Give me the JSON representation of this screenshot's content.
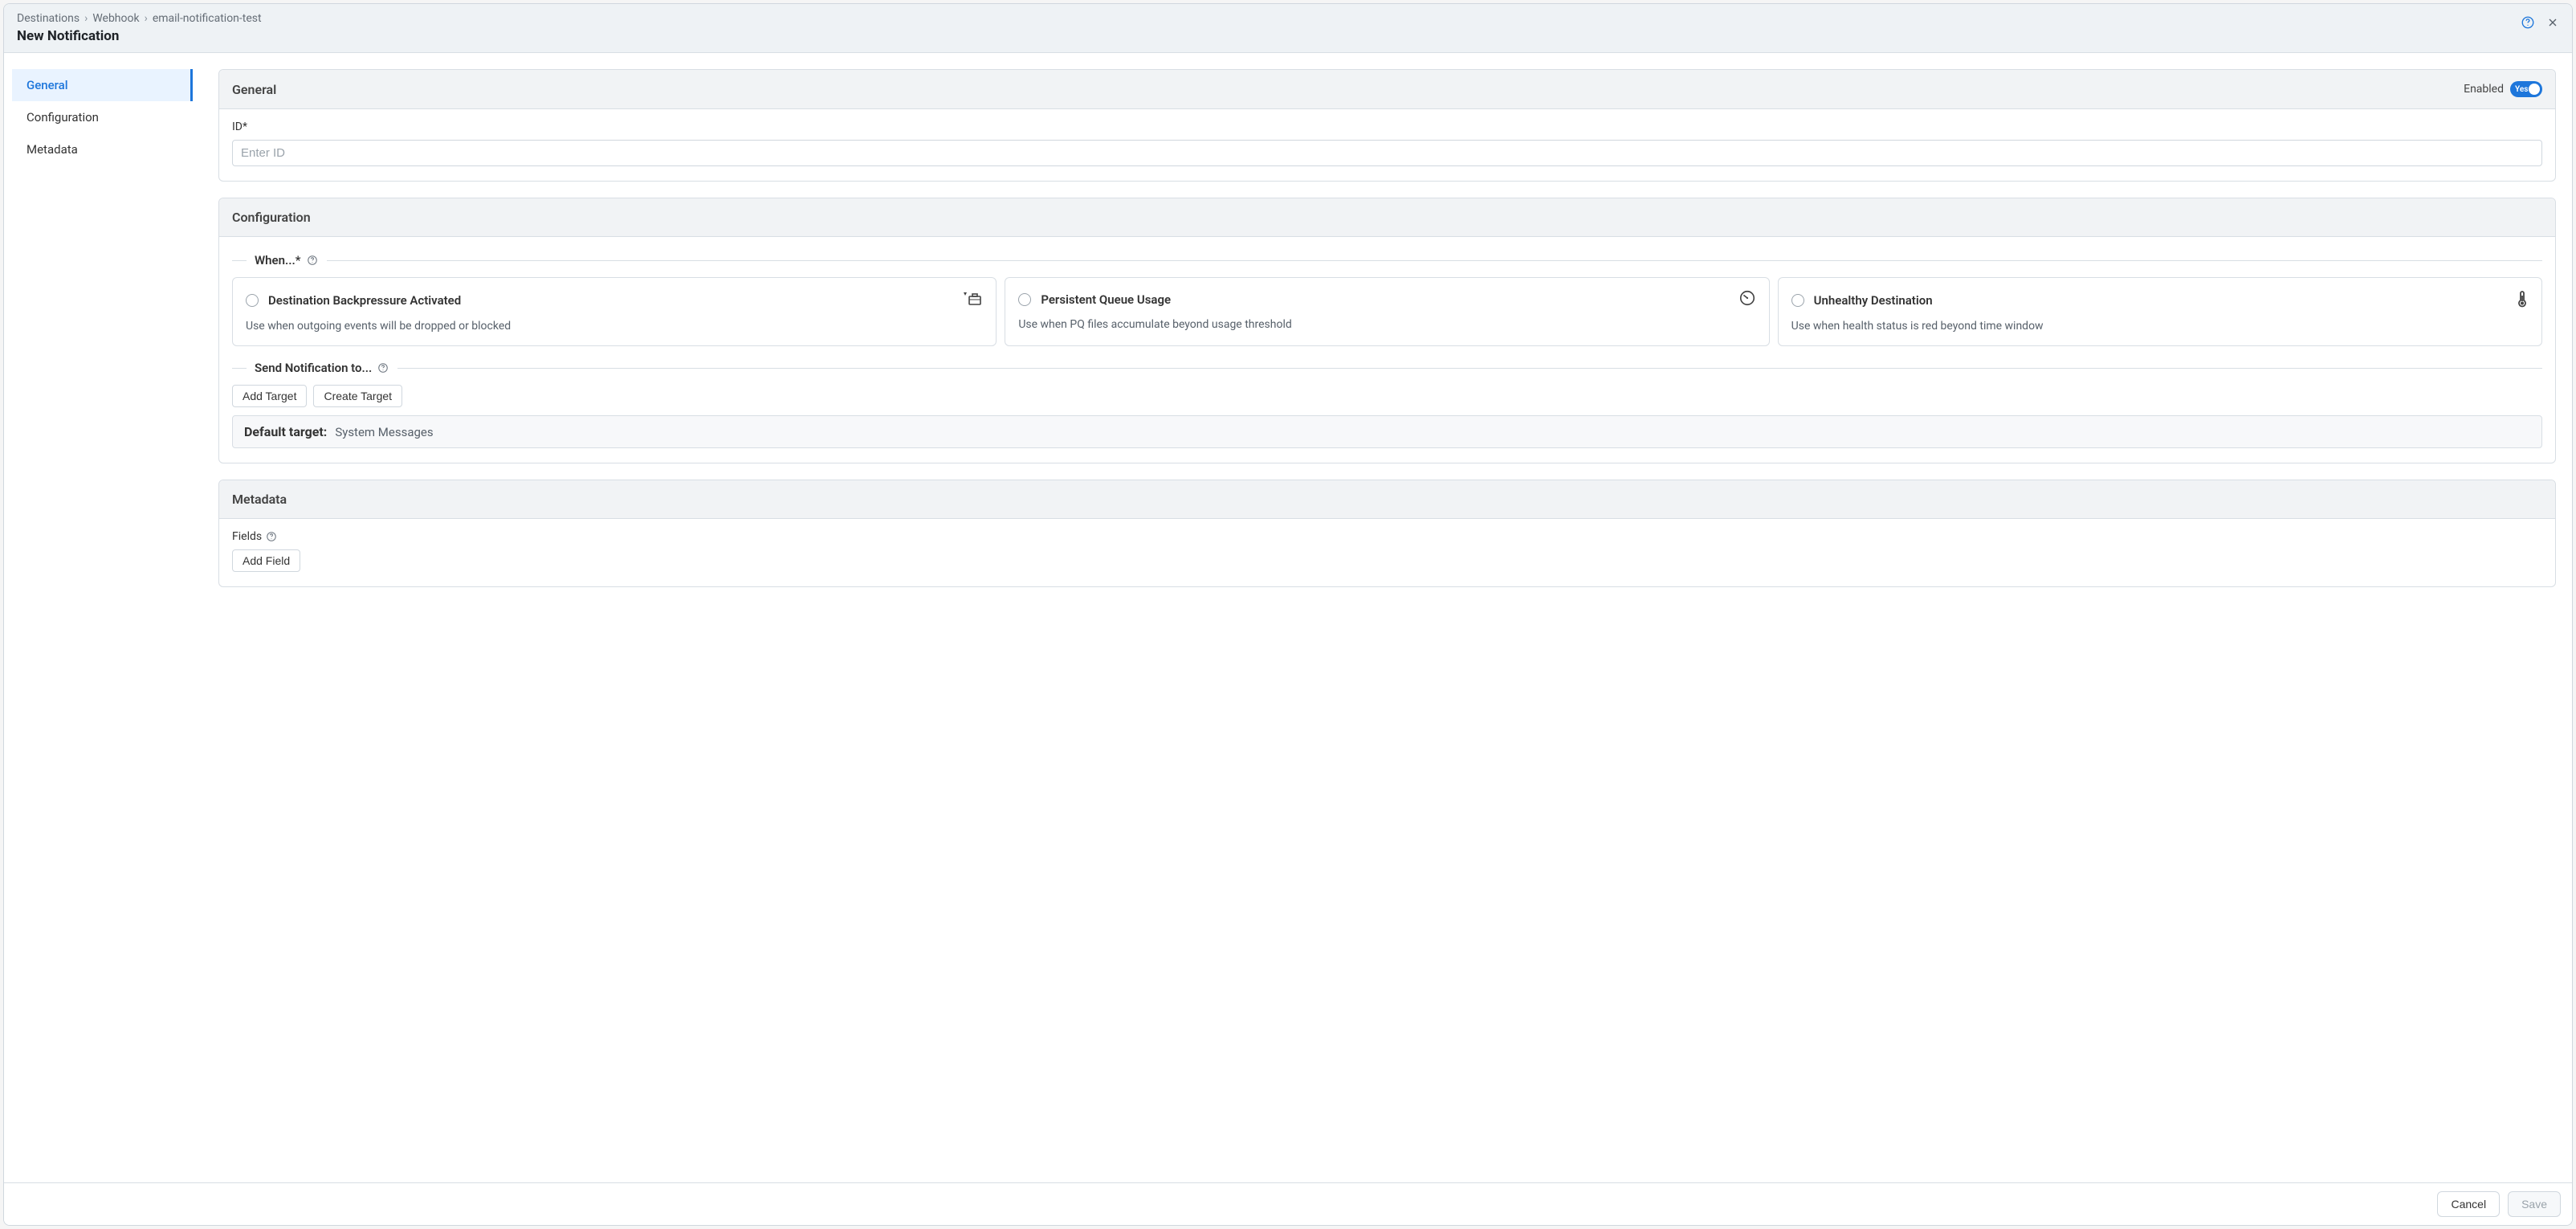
{
  "breadcrumb": [
    "Destinations",
    "Webhook",
    "email-notification-test"
  ],
  "title": "New Notification",
  "sidebar": {
    "items": [
      {
        "label": "General"
      },
      {
        "label": "Configuration"
      },
      {
        "label": "Metadata"
      }
    ]
  },
  "general": {
    "header": "General",
    "enabled_label": "Enabled",
    "toggle_state": "Yes",
    "id_label": "ID*",
    "id_placeholder": "Enter ID"
  },
  "config": {
    "header": "Configuration",
    "when_label": "When...*",
    "options": [
      {
        "title": "Destination Backpressure Activated",
        "desc": "Use when outgoing events will be dropped or blocked"
      },
      {
        "title": "Persistent Queue Usage",
        "desc": "Use when PQ files accumulate beyond usage threshold"
      },
      {
        "title": "Unhealthy Destination",
        "desc": "Use when health status is red beyond time window"
      }
    ],
    "send_label": "Send Notification to...",
    "add_target": "Add Target",
    "create_target": "Create Target",
    "default_target_label": "Default target:",
    "default_target_value": "System Messages"
  },
  "metadata": {
    "header": "Metadata",
    "fields_label": "Fields",
    "add_field": "Add Field"
  },
  "footer": {
    "cancel": "Cancel",
    "save": "Save"
  }
}
